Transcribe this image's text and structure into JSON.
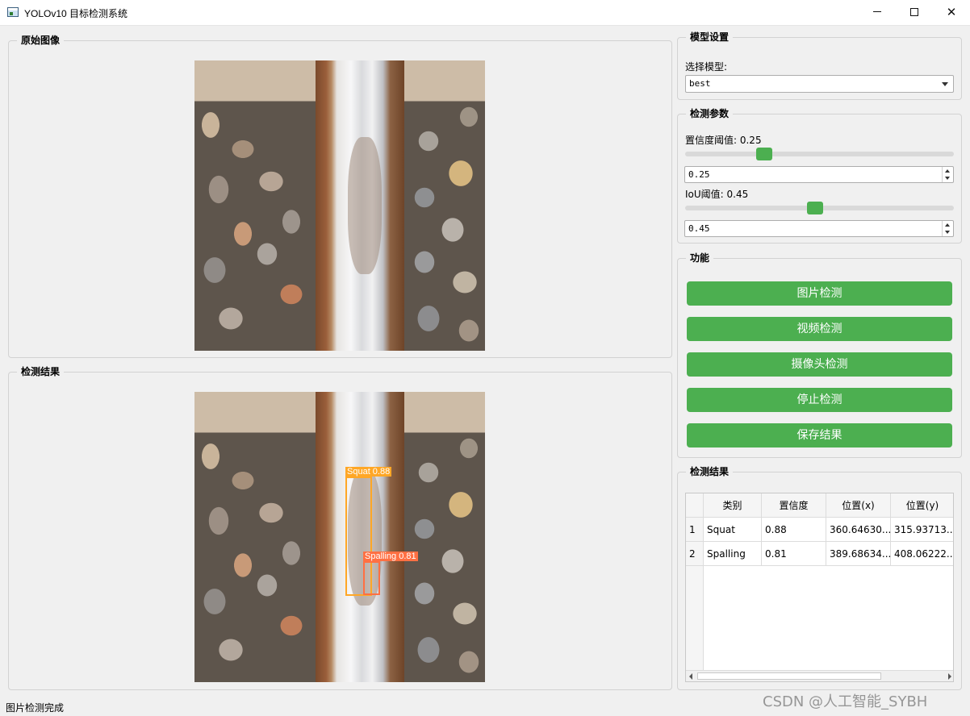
{
  "window": {
    "title": "YOLOv10 目标检测系统"
  },
  "panels": {
    "original": {
      "title": "原始图像"
    },
    "result": {
      "title": "检测结果"
    }
  },
  "model_settings": {
    "title": "模型设置",
    "select_label": "选择模型:",
    "selected": "best"
  },
  "params": {
    "title": "检测参数",
    "conf_label": "置信度阈值: 0.25",
    "conf_value": "0.25",
    "conf_level": 0.25,
    "iou_label": "IoU阈值: 0.45",
    "iou_value": "0.45",
    "iou_level": 0.45
  },
  "functions": {
    "title": "功能",
    "buttons": [
      "图片检测",
      "视频检测",
      "摄像头检测",
      "停止检测",
      "保存结果"
    ]
  },
  "results": {
    "title": "检测结果",
    "columns": [
      "类别",
      "置信度",
      "位置(x)",
      "位置(y)"
    ],
    "rows": [
      {
        "index": "1",
        "cls": "Squat",
        "conf": "0.88",
        "x": "360.64630...",
        "y": "315.93713..."
      },
      {
        "index": "2",
        "cls": "Spalling",
        "conf": "0.81",
        "x": "389.68634...",
        "y": "408.06222..."
      }
    ]
  },
  "detections": [
    {
      "label": "Squat  0.88",
      "color": "#ffa726"
    },
    {
      "label": "Spalling  0.81",
      "color": "#ff7043"
    }
  ],
  "status": {
    "text": "图片检测完成"
  },
  "watermark": {
    "text": "CSDN @人工智能_SYBH"
  },
  "colors": {
    "accent": "#4caf50"
  }
}
